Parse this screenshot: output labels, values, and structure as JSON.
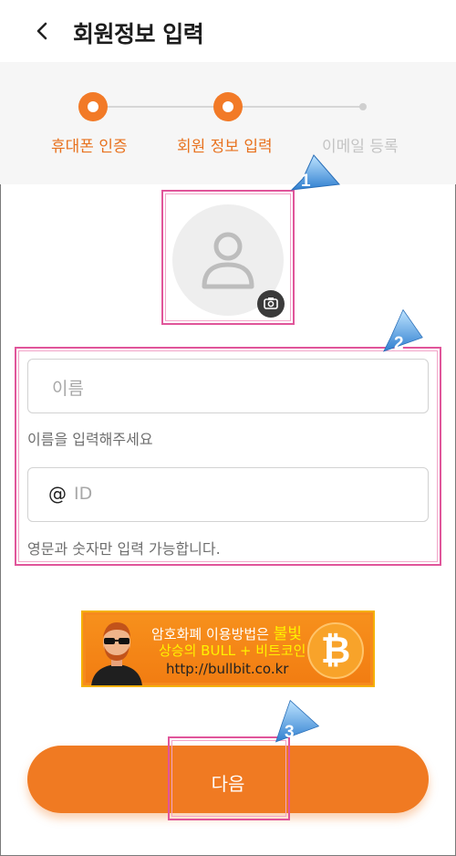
{
  "header": {
    "back_icon": "chevron-left-icon",
    "title": "회원정보 입력"
  },
  "steps": [
    {
      "label": "휴대폰 인증",
      "state": "done"
    },
    {
      "label": "회원 정보 입력",
      "state": "current"
    },
    {
      "label": "이메일 등록",
      "state": "pending"
    }
  ],
  "profile": {
    "avatar_icon": "person-icon",
    "camera_icon": "camera-icon"
  },
  "form": {
    "name_placeholder": "이름",
    "name_help": "이름을 입력해주세요",
    "id_prefix": "@",
    "id_placeholder": "ID",
    "id_help": "영문과 숫자만 입력 가능합니다."
  },
  "banner": {
    "line1_prefix": "암호화폐 이용방법은",
    "line1_highlight": "불빛",
    "line2": "상승의 BULL + 비트코인",
    "line3": "http://bullbit.co.kr",
    "coin_symbol": "₿"
  },
  "next_button": {
    "label": "다음"
  },
  "callouts": [
    "1",
    "2",
    "3"
  ],
  "colors": {
    "accent": "#f07a22",
    "highlight_box": "#e0559a",
    "callout": "#3a8fd9"
  }
}
